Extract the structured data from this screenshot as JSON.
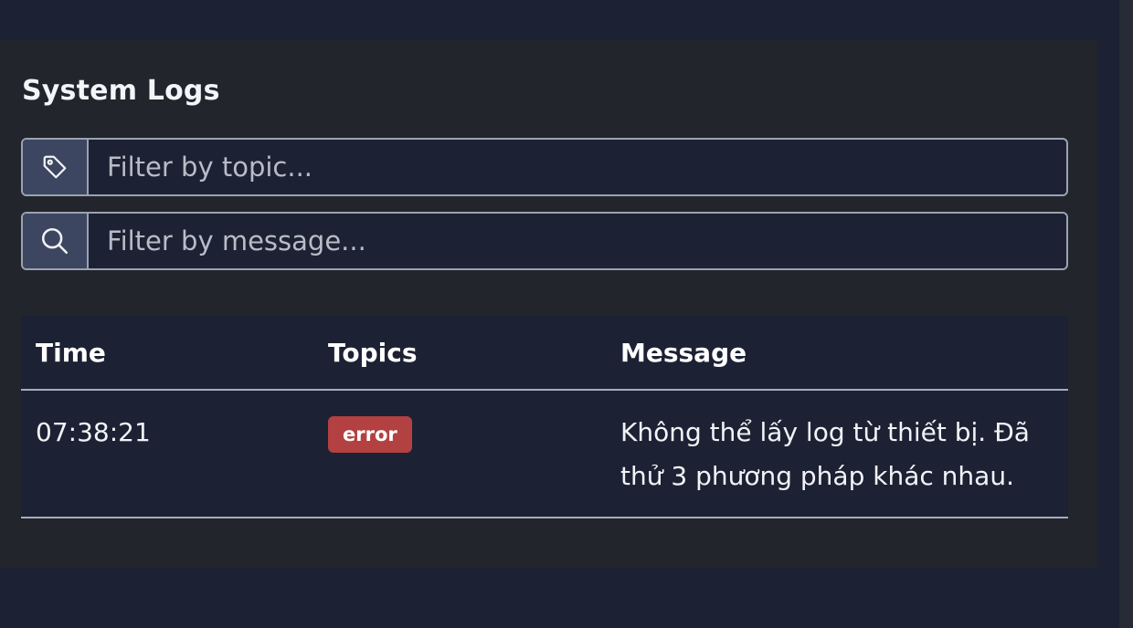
{
  "panel": {
    "title": "System Logs"
  },
  "filters": {
    "topic": {
      "placeholder": "Filter by topic...",
      "value": "",
      "icon": "tag-icon"
    },
    "message": {
      "placeholder": "Filter by message...",
      "value": "",
      "icon": "search-icon"
    }
  },
  "table": {
    "headers": {
      "time": "Time",
      "topics": "Topics",
      "message": "Message"
    },
    "rows": [
      {
        "time": "07:38:21",
        "topic": "error",
        "message": "Không thể lấy log từ thiết bị. Đã thử 3 phương pháp khác nhau."
      }
    ]
  },
  "colors": {
    "background": "#1c2233",
    "panel": "#22252c",
    "addon": "#3d4660",
    "error_badge": "#b34141",
    "border": "#9ba2b0"
  }
}
